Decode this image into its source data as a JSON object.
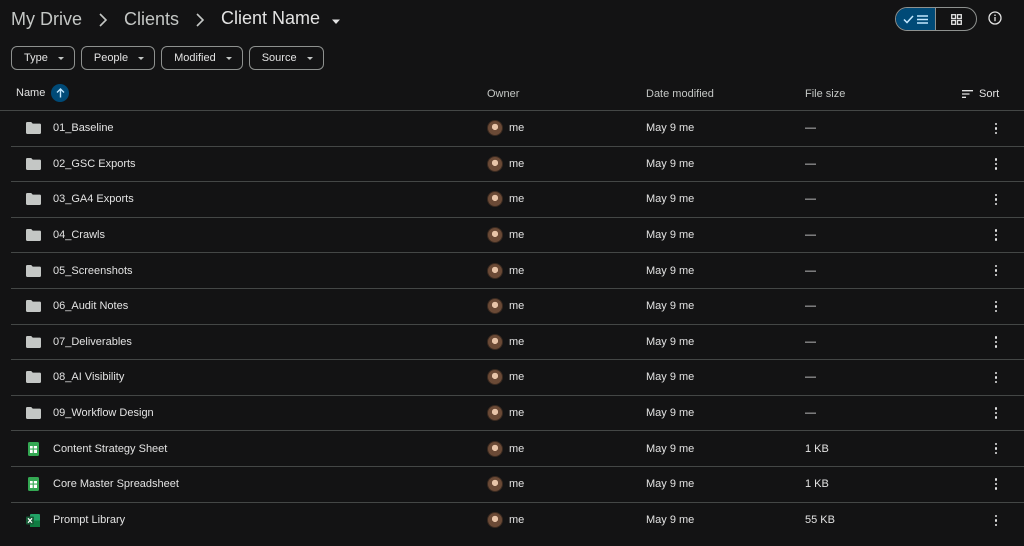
{
  "breadcrumb": {
    "items": [
      {
        "label": "My Drive"
      },
      {
        "label": "Clients"
      },
      {
        "label": "Client Name"
      }
    ]
  },
  "filters": [
    {
      "label": "Type"
    },
    {
      "label": "People"
    },
    {
      "label": "Modified"
    },
    {
      "label": "Source"
    }
  ],
  "columns": {
    "name": "Name",
    "owner": "Owner",
    "date_modified": "Date modified",
    "file_size": "File size",
    "sort": "Sort"
  },
  "rows": [
    {
      "icon": "folder-icon",
      "name": "01_Baseline",
      "owner": "me",
      "date": "May 9 me",
      "size": "—"
    },
    {
      "icon": "folder-icon",
      "name": "02_GSC Exports",
      "owner": "me",
      "date": "May 9 me",
      "size": "—"
    },
    {
      "icon": "folder-icon",
      "name": "03_GA4 Exports",
      "owner": "me",
      "date": "May 9 me",
      "size": "—"
    },
    {
      "icon": "folder-icon",
      "name": "04_Crawls",
      "owner": "me",
      "date": "May 9 me",
      "size": "—"
    },
    {
      "icon": "folder-icon",
      "name": "05_Screenshots",
      "owner": "me",
      "date": "May 9 me",
      "size": "—"
    },
    {
      "icon": "folder-icon",
      "name": "06_Audit Notes",
      "owner": "me",
      "date": "May 9 me",
      "size": "—"
    },
    {
      "icon": "folder-icon",
      "name": "07_Deliverables",
      "owner": "me",
      "date": "May 9 me",
      "size": "—"
    },
    {
      "icon": "folder-icon",
      "name": "08_AI Visibility",
      "owner": "me",
      "date": "May 9 me",
      "size": "—"
    },
    {
      "icon": "folder-icon",
      "name": "09_Workflow Design",
      "owner": "me",
      "date": "May 9 me",
      "size": "—"
    },
    {
      "icon": "sheets-icon",
      "name": "Content Strategy Sheet",
      "owner": "me",
      "date": "May 9 me",
      "size": "1 KB"
    },
    {
      "icon": "sheets-icon",
      "name": "Core Master Spreadsheet",
      "owner": "me",
      "date": "May 9 me",
      "size": "1 KB"
    },
    {
      "icon": "excel-icon",
      "name": "Prompt Library",
      "owner": "me",
      "date": "May 9 me",
      "size": "55 KB"
    }
  ],
  "colors": {
    "background": "#131314",
    "accent": "#004a77",
    "divider": "#444746",
    "sheets_green": "#34a853",
    "excel_green": "#107c41"
  }
}
